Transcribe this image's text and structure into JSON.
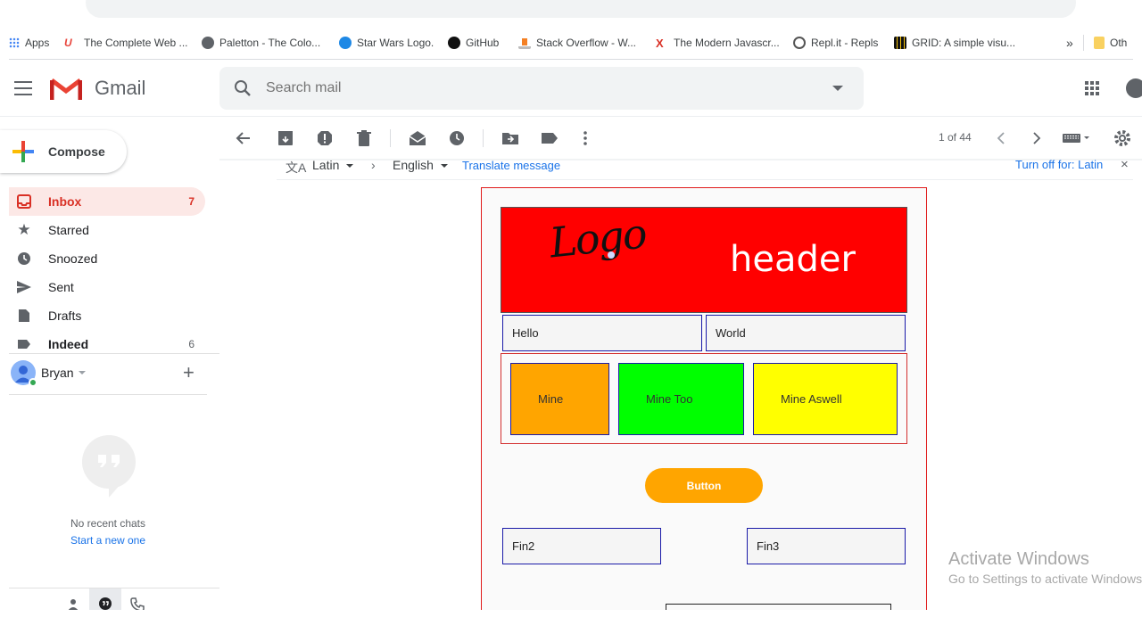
{
  "bookmarks": {
    "apps": "Apps",
    "items": [
      {
        "label": "The Complete Web ...",
        "icon": "udemy-icon"
      },
      {
        "label": "Paletton - The Colo...",
        "icon": "paletton-icon"
      },
      {
        "label": "Star Wars Logo.",
        "icon": "wikipedia-icon"
      },
      {
        "label": "GitHub",
        "icon": "github-icon"
      },
      {
        "label": "Stack Overflow - W...",
        "icon": "stackoverflow-icon"
      },
      {
        "label": "The Modern Javascr...",
        "icon": "modern-js-icon"
      },
      {
        "label": "Repl.it - Repls",
        "icon": "replit-icon"
      },
      {
        "label": "GRID: A simple visu...",
        "icon": "grid-icon"
      }
    ],
    "more": "»",
    "other": "Oth"
  },
  "gmail": {
    "product": "Gmail",
    "search_placeholder": "Search mail",
    "colors": {
      "red": "#d93025",
      "blue": "#1a73e8"
    }
  },
  "sidebar": {
    "compose": "Compose",
    "items": [
      {
        "label": "Inbox",
        "count": "7",
        "icon": "inbox-icon"
      },
      {
        "label": "Starred",
        "count": "",
        "icon": "star-icon"
      },
      {
        "label": "Snoozed",
        "count": "",
        "icon": "clock-icon"
      },
      {
        "label": "Sent",
        "count": "",
        "icon": "send-icon"
      },
      {
        "label": "Drafts",
        "count": "",
        "icon": "draft-icon"
      },
      {
        "label": "Indeed",
        "count": "6",
        "icon": "label-icon"
      }
    ],
    "hangouts_user": "Bryan",
    "no_chats": "No recent chats",
    "start_new": "Start a new one"
  },
  "toolbar": {
    "pager": "1 of 44"
  },
  "translate": {
    "source": "Latin",
    "target": "English",
    "action": "Translate message",
    "turn_off": "Turn off for: Latin"
  },
  "email": {
    "logo": "Logo",
    "header": "header",
    "cells": {
      "hello": "Hello",
      "world": "World",
      "fin2": "Fin2",
      "fin3": "Fin3"
    },
    "tiles": [
      {
        "label": "Mine",
        "color": "#ffa500"
      },
      {
        "label": "Mine Too",
        "color": "#00ff00"
      },
      {
        "label": "Mine Aswell",
        "color": "#ffff00"
      }
    ],
    "button": "Button",
    "colors": {
      "header_bg": "#ff0000",
      "button_bg": "#ffa500"
    }
  },
  "windows": {
    "activate": "Activate Windows",
    "settings": "Go to Settings to activate Windows."
  }
}
